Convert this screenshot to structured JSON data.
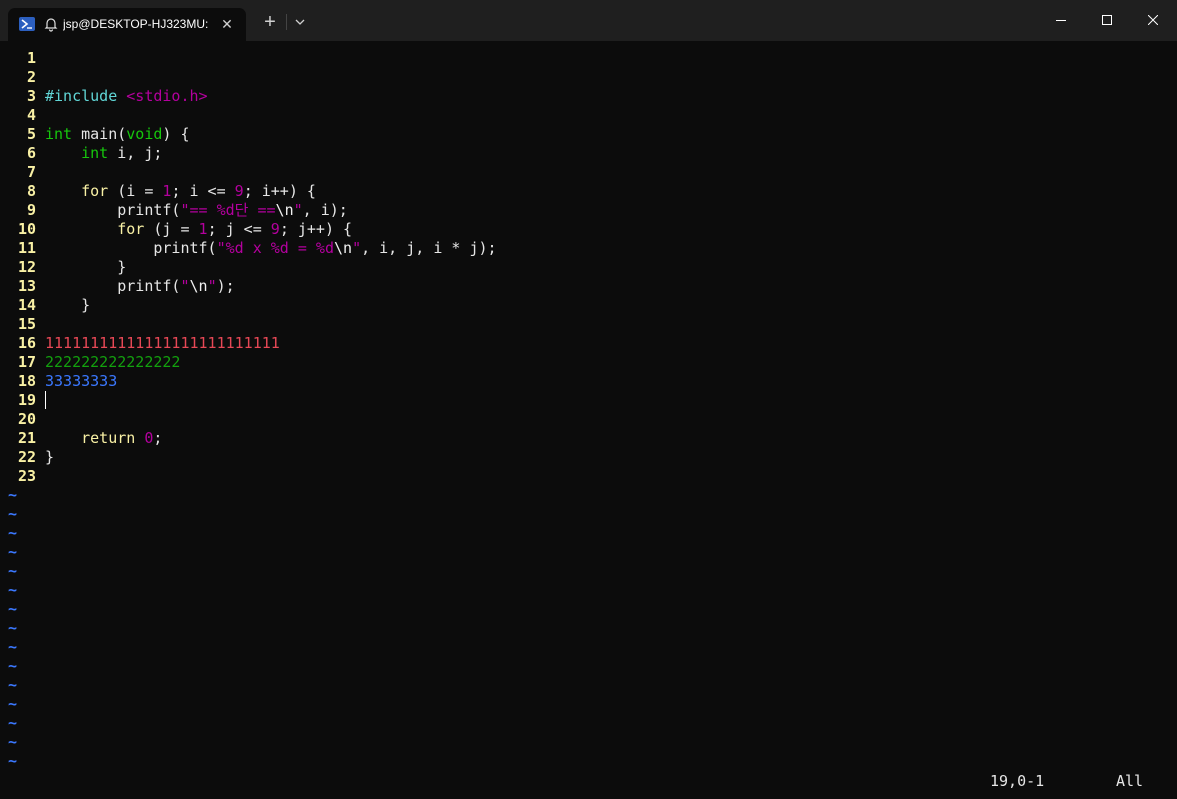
{
  "window": {
    "tab_title": "jsp@DESKTOP-HJ323MU:",
    "tab_close": "✕",
    "new_tab": "+"
  },
  "editor": {
    "lines": [
      {
        "n": "1"
      },
      {
        "n": "2"
      },
      {
        "n": "3"
      },
      {
        "n": "4"
      },
      {
        "n": "5"
      },
      {
        "n": "6"
      },
      {
        "n": "7"
      },
      {
        "n": "8"
      },
      {
        "n": "9"
      },
      {
        "n": "10"
      },
      {
        "n": "11"
      },
      {
        "n": "12"
      },
      {
        "n": "13"
      },
      {
        "n": "14"
      },
      {
        "n": "15"
      },
      {
        "n": "16"
      },
      {
        "n": "17"
      },
      {
        "n": "18"
      },
      {
        "n": "19"
      },
      {
        "n": "20"
      },
      {
        "n": "21"
      },
      {
        "n": "22"
      },
      {
        "n": "23"
      }
    ],
    "code": {
      "include_kw": "#include",
      "include_file": "<stdio.h>",
      "main_int": "int",
      "main_rest1": " main(",
      "main_void": "void",
      "main_rest2": ") {",
      "decl_int": "int",
      "decl_rest": " i, j;",
      "for1_kw": "for",
      "for1_a": " (i = ",
      "for1_n1": "1",
      "for1_b": "; i <= ",
      "for1_n2": "9",
      "for1_c": "; i++) {",
      "printf1_a": "printf(",
      "printf1_s1": "\"== %d단 ==",
      "printf1_esc": "\\n",
      "printf1_s2": "\"",
      "printf1_b": ", i);",
      "for2_kw": "for",
      "for2_a": " (j = ",
      "for2_n1": "1",
      "for2_b": "; j <= ",
      "for2_n2": "9",
      "for2_c": "; j++) {",
      "printf2_a": "printf(",
      "printf2_s1": "\"%d x %d = %d",
      "printf2_esc": "\\n",
      "printf2_s2": "\"",
      "printf2_b": ", i, j, i * j);",
      "close_inner": "}",
      "printf3_a": "printf(",
      "printf3_s1": "\"",
      "printf3_esc": "\\n",
      "printf3_s2": "\"",
      "printf3_b": ");",
      "close_outer": "}",
      "ones": "11111111111111111111111111",
      "twos": "222222222222222",
      "threes": "33333333",
      "return_kw": "return",
      "return_sp": " ",
      "return_n": "0",
      "return_semi": ";",
      "close_main": "}"
    },
    "tilde": "~",
    "tilde_count": 15
  },
  "status": {
    "position": "19,0-1",
    "scroll": "All"
  },
  "colors": {
    "background": "#0c0c0c",
    "line_number": "#f9f1a5",
    "tilde": "#3b78ff",
    "string": "#b4009e",
    "type": "#16c60c",
    "preproc": "#61d6d6"
  }
}
